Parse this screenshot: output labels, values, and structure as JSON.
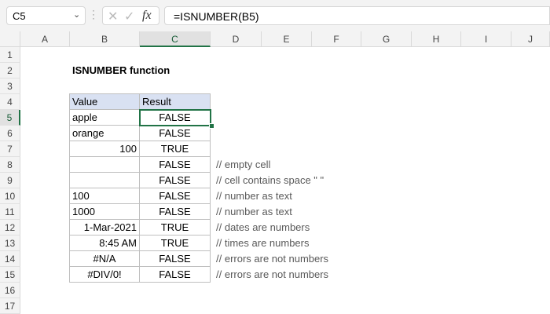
{
  "name_box": "C5",
  "formula": "=ISNUMBER(B5)",
  "fx_label": "fx",
  "columns": [
    "A",
    "B",
    "C",
    "D",
    "E",
    "F",
    "G",
    "H",
    "I",
    "J"
  ],
  "rows": [
    "1",
    "2",
    "3",
    "4",
    "5",
    "6",
    "7",
    "8",
    "9",
    "10",
    "11",
    "12",
    "13",
    "14",
    "15",
    "16",
    "17"
  ],
  "title": "ISNUMBER function",
  "table": {
    "headers": [
      "Value",
      "Result"
    ],
    "rows": [
      {
        "value": "apple",
        "align": "l",
        "result": "FALSE",
        "comment": ""
      },
      {
        "value": "orange",
        "align": "l",
        "result": "FALSE",
        "comment": ""
      },
      {
        "value": "100",
        "align": "r",
        "result": "TRUE",
        "comment": ""
      },
      {
        "value": "",
        "align": "l",
        "result": "FALSE",
        "comment": "// empty cell"
      },
      {
        "value": "",
        "align": "l",
        "result": "FALSE",
        "comment": "// cell contains space \" \""
      },
      {
        "value": "100",
        "align": "l",
        "result": "FALSE",
        "comment": "// number as text"
      },
      {
        "value": "1000",
        "align": "l",
        "result": "FALSE",
        "comment": "// number as text"
      },
      {
        "value": "1-Mar-2021",
        "align": "r",
        "result": "TRUE",
        "comment": "// dates are numbers"
      },
      {
        "value": "8:45 AM",
        "align": "r",
        "result": "TRUE",
        "comment": "// times are numbers"
      },
      {
        "value": "#N/A",
        "align": "c",
        "result": "FALSE",
        "comment": "// errors are not numbers"
      },
      {
        "value": "#DIV/0!",
        "align": "c",
        "result": "FALSE",
        "comment": "// errors are not numbers"
      }
    ]
  }
}
